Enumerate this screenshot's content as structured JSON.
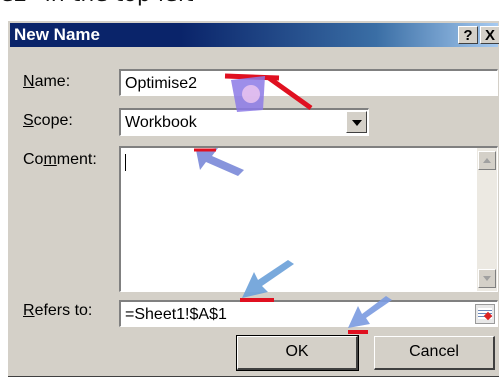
{
  "caption": "e2\" in the top left",
  "dialog": {
    "title": "New Name",
    "help_label": "?",
    "close_label": "X",
    "name_label_key": "N",
    "name_label_rest": "ame:",
    "name_value": "Optimise2",
    "scope_label_key": "S",
    "scope_label_rest": "cope:",
    "scope_value": "Workbook",
    "comment_label_pre": "Co",
    "comment_label_key": "m",
    "comment_label_rest": "ment:",
    "comment_value": "",
    "refers_label_key": "R",
    "refers_label_rest": "efers to:",
    "refers_value": "=Sheet1!$A$1",
    "ok_label": "OK",
    "cancel_label": "Cancel"
  },
  "colors": {
    "titlebar": "#0a246a",
    "dialog_bg": "#d4d0c8",
    "arrow_red": "#e01020"
  },
  "icons": [
    "dropdown-arrow-icon",
    "scroll-up-icon",
    "scroll-down-icon",
    "range-select-icon",
    "pointer-arrow-icon"
  ]
}
